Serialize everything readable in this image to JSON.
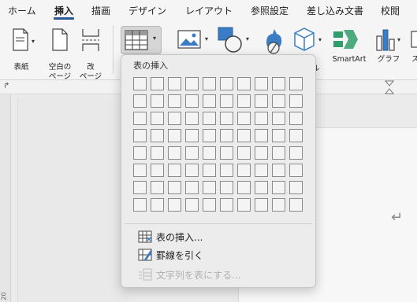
{
  "tabs": [
    {
      "label": "ホーム",
      "active": false
    },
    {
      "label": "挿入",
      "active": true
    },
    {
      "label": "描画",
      "active": false
    },
    {
      "label": "デザイン",
      "active": false
    },
    {
      "label": "レイアウト",
      "active": false
    },
    {
      "label": "参照設定",
      "active": false
    },
    {
      "label": "差し込み文書",
      "active": false
    },
    {
      "label": "校閲",
      "active": false
    }
  ],
  "ribbon": {
    "cover_label": "表紙",
    "blank_page_label_1": "空白の",
    "blank_page_label_2": "ページ",
    "page_break_label_1": "改",
    "page_break_label_2": "ページ",
    "smartart_label": "SmartArt",
    "graph_label": "グラフ",
    "partial_label_1": "ル",
    "partial_label_2": "ス"
  },
  "ruler": {
    "vertical_number": "20"
  },
  "table_dropdown": {
    "title": "表の挿入",
    "grid_rows": 8,
    "grid_cols": 10,
    "items": [
      {
        "label": "表の挿入...",
        "enabled": true
      },
      {
        "label": "罫線を引く",
        "enabled": true
      },
      {
        "label": "文字列を表にする...",
        "enabled": false
      }
    ]
  },
  "document": {
    "return_mark": "↵"
  },
  "colors": {
    "accent": "#2b5797",
    "panel_bg": "#ececec"
  }
}
